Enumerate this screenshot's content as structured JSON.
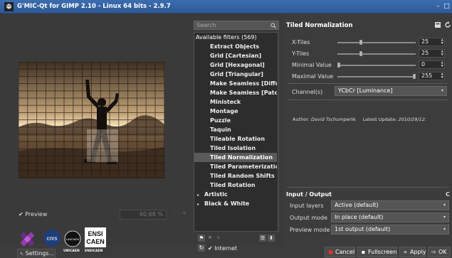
{
  "window": {
    "title": "G'MIC-Qt for GIMP 2.10 - Linux 64 bits - 2.9.7"
  },
  "preview": {
    "preview_label": "Preview",
    "zoom_value": "60,68 %",
    "zoom_minus": "-",
    "zoom_plus": "+",
    "logos": [
      "GREYC",
      "CNRS",
      "UNICAEN",
      "ENSICAEN"
    ],
    "logo_mark_cnrs": "cnrs",
    "logo_mark_unicaen": "UNICAEN",
    "logo_mark_ensi": "ENSI",
    "logo_mark_caen": "CAEN",
    "settings_label": "Settings..."
  },
  "filters": {
    "search_placeholder": "Search",
    "header": "Available filters (569)",
    "items": [
      "Extract Objects",
      "Grid [Cartesian]",
      "Grid [Hexagonal]",
      "Grid [Triangular]",
      "Make Seamless [Diffusi",
      "Make Seamless [Patch-",
      "Ministeck",
      "Montage",
      "Puzzle",
      "Taquin",
      "Tileable Rotation",
      "Tiled Isolation",
      "Tiled Normalization",
      "Tiled Parameterization",
      "Tiled Random Shifts",
      "Tiled Rotation"
    ],
    "selected_index": 12,
    "categories": [
      "Artistic",
      "Black & White"
    ],
    "internet_label": "Internet"
  },
  "params": {
    "filter_title": "Tiled Normalization",
    "sliders": [
      {
        "label": "X-Tiles",
        "value": "25",
        "fraction": 0.3
      },
      {
        "label": "Y-Tiles",
        "value": "25",
        "fraction": 0.3
      },
      {
        "label": "Minimal Value",
        "value": "0",
        "fraction": 0.0
      },
      {
        "label": "Maximal Value",
        "value": "255",
        "fraction": 1.0
      }
    ],
    "channel_label": "Channel(s)",
    "channel_value": "YCbCr [Luminance]",
    "author_prefix": "Author:",
    "author_name": "David Tschumperlé.",
    "update_prefix": "Latest Update:",
    "update_date": "2010/29/12."
  },
  "io": {
    "title": "Input / Output",
    "rows": [
      {
        "label": "Input layers",
        "value": "Active (default)"
      },
      {
        "label": "Output mode",
        "value": "In place (default)"
      },
      {
        "label": "Preview mode",
        "value": "1st output (default)"
      }
    ]
  },
  "buttons": {
    "cancel": "Cancel",
    "fullscreen": "Fullscreen",
    "apply": "Apply",
    "ok": "OK"
  },
  "colors": {
    "titlebar": "#3163a7",
    "selection": "#5a5a5a",
    "cancel_icon": "#e03030"
  }
}
